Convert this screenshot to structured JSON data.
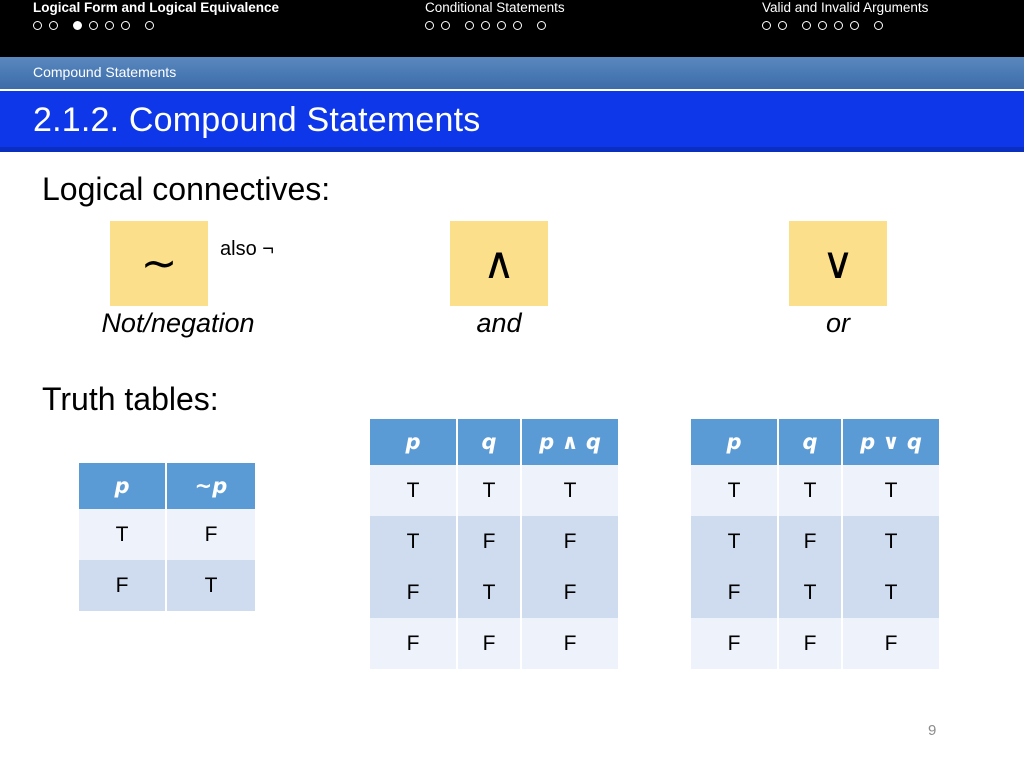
{
  "nav": {
    "sections": [
      {
        "title": "Logical Form and Logical Equivalence",
        "bold": true,
        "dots": [
          "empty",
          "empty",
          "filled",
          "empty",
          "empty",
          "empty",
          "empty"
        ]
      },
      {
        "title": "Conditional Statements",
        "bold": false,
        "dots": [
          "empty",
          "empty",
          "empty",
          "empty",
          "empty",
          "empty",
          "empty"
        ]
      },
      {
        "title": "Valid and Invalid Arguments",
        "bold": false,
        "dots": [
          "empty",
          "empty",
          "empty",
          "empty",
          "empty",
          "empty",
          "empty"
        ]
      }
    ]
  },
  "section_band": {
    "label": "Compound Statements"
  },
  "title_band": {
    "title": "2.1.2. Compound Statements"
  },
  "body": {
    "heading_connectives": "Logical connectives:",
    "heading_truth_tables": "Truth tables:",
    "connectives": [
      {
        "symbol": "~",
        "label": "Not/negation",
        "also": "also ¬"
      },
      {
        "symbol": "∧",
        "label": "and",
        "also": ""
      },
      {
        "symbol": "∨",
        "label": "or",
        "also": ""
      }
    ]
  },
  "tables": [
    {
      "headers": [
        "p",
        "~p"
      ],
      "rows": [
        [
          "T",
          "F"
        ],
        [
          "F",
          "T"
        ]
      ]
    },
    {
      "headers": [
        "p",
        "q",
        "p ∧ q"
      ],
      "rows": [
        [
          "T",
          "T",
          "T"
        ],
        [
          "T",
          "F",
          "F"
        ],
        [
          "F",
          "T",
          "F"
        ],
        [
          "F",
          "F",
          "F"
        ]
      ]
    },
    {
      "headers": [
        "p",
        "q",
        "p ∨ q"
      ],
      "rows": [
        [
          "T",
          "T",
          "T"
        ],
        [
          "T",
          "F",
          "T"
        ],
        [
          "F",
          "T",
          "T"
        ],
        [
          "F",
          "F",
          "F"
        ]
      ]
    }
  ],
  "footer": {
    "slide_number": "9"
  },
  "colors": {
    "topbar": "#000000",
    "section_band": "#4a7ab4",
    "title_band": "#0d37e8",
    "connective_box": "#fbdf8b",
    "table_header": "#5b9bd5",
    "table_row_odd": "#eef2fa",
    "table_row_even": "#cfdcef"
  }
}
